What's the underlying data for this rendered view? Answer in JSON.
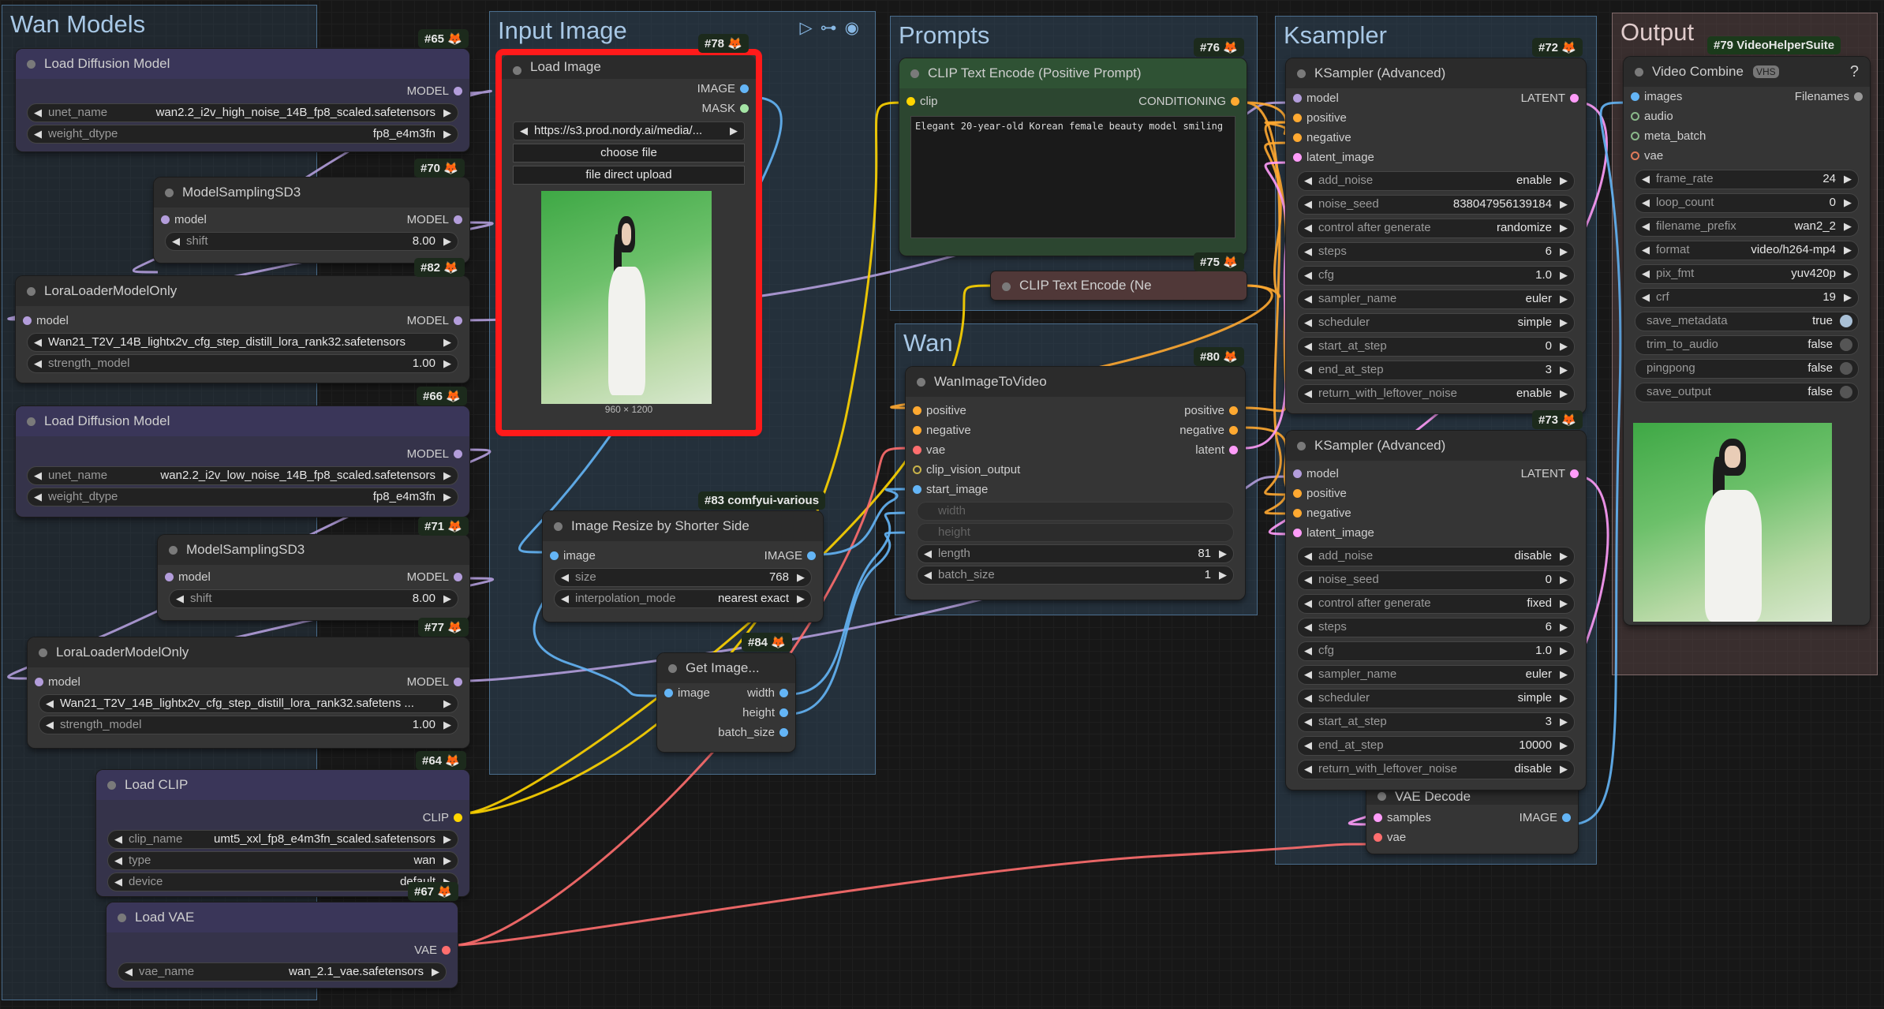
{
  "groups": {
    "wan_models": "Wan Models",
    "input_image": "Input Image",
    "prompts": "Prompts",
    "ksampler": "Ksampler",
    "output": "Output",
    "wan": "Wan"
  },
  "badges": {
    "b65": "#65",
    "b70": "#70",
    "b82": "#82",
    "b66": "#66",
    "b71": "#71",
    "b77": "#77",
    "b64": "#64",
    "b67": "#67",
    "b78": "#78",
    "b83": "#83 comfyui-various",
    "b84": "#84",
    "b76": "#76",
    "b75": "#75",
    "b80": "#80",
    "b72": "#72",
    "b73": "#73",
    "b79": "#79 VideoHelperSuite"
  },
  "fox": "🦊",
  "n65": {
    "title": "Load Diffusion Model",
    "out": "MODEL",
    "unet_k": "unet_name",
    "unet_v": "wan2.2_i2v_high_noise_14B_fp8_scaled.safetensors",
    "dt_k": "weight_dtype",
    "dt_v": "fp8_e4m3fn"
  },
  "n70": {
    "title": "ModelSamplingSD3",
    "in": "model",
    "out": "MODEL",
    "k": "shift",
    "v": "8.00"
  },
  "n82": {
    "title": "LoraLoaderModelOnly",
    "in": "model",
    "out": "MODEL",
    "lora_v": "Wan21_T2V_14B_lightx2v_cfg_step_distill_lora_rank32.safetensors",
    "s_k": "strength_model",
    "s_v": "1.00"
  },
  "n66": {
    "title": "Load Diffusion Model",
    "out": "MODEL",
    "unet_k": "unet_name",
    "unet_v": "wan2.2_i2v_low_noise_14B_fp8_scaled.safetensors",
    "dt_k": "weight_dtype",
    "dt_v": "fp8_e4m3fn"
  },
  "n71": {
    "title": "ModelSamplingSD3",
    "in": "model",
    "out": "MODEL",
    "k": "shift",
    "v": "8.00"
  },
  "n77": {
    "title": "LoraLoaderModelOnly",
    "in": "model",
    "out": "MODEL",
    "lora_v": "Wan21_T2V_14B_lightx2v_cfg_step_distill_lora_rank32.safetens ...",
    "s_k": "strength_model",
    "s_v": "1.00"
  },
  "n64": {
    "title": "Load CLIP",
    "out": "CLIP",
    "c_k": "clip_name",
    "c_v": "umt5_xxl_fp8_e4m3fn_scaled.safetensors",
    "t_k": "type",
    "t_v": "wan",
    "d_k": "device",
    "d_v": "default"
  },
  "n67": {
    "title": "Load VAE",
    "out": "VAE",
    "k": "vae_name",
    "v": "wan_2.1_vae.safetensors"
  },
  "n78": {
    "title": "Load Image",
    "out1": "IMAGE",
    "out2": "MASK",
    "url": "https://s3.prod.nordy.ai/media/...",
    "choose": "choose file",
    "upload": "file direct upload",
    "dims": "960 × 1200"
  },
  "n83": {
    "title": "Image Resize by Shorter Side",
    "in": "image",
    "out": "IMAGE",
    "size_k": "size",
    "size_v": "768",
    "interp_k": "interpolation_mode",
    "interp_v": "nearest exact"
  },
  "n84": {
    "title": "Get Image...",
    "in": "image",
    "o1": "width",
    "o2": "height",
    "o3": "batch_size"
  },
  "n76": {
    "title": "CLIP Text Encode (Positive Prompt)",
    "in": "clip",
    "out": "CONDITIONING",
    "text": "Elegant 20-year-old Korean female beauty model smiling"
  },
  "n75": {
    "title": "CLIP Text Encode (Ne"
  },
  "n80": {
    "title": "WanImageToVideo",
    "i1": "positive",
    "i2": "negative",
    "i3": "vae",
    "i4": "clip_vision_output",
    "i5": "start_image",
    "o1": "positive",
    "o2": "negative",
    "o3": "latent",
    "w1": "width",
    "w2": "height",
    "len_k": "length",
    "len_v": "81",
    "bs_k": "batch_size",
    "bs_v": "1"
  },
  "n72": {
    "title": "KSampler (Advanced)",
    "i1": "model",
    "i2": "positive",
    "i3": "negative",
    "i4": "latent_image",
    "out": "LATENT",
    "widgets": [
      [
        "add_noise",
        "enable"
      ],
      [
        "noise_seed",
        "838047956139184"
      ],
      [
        "control after generate",
        "randomize"
      ],
      [
        "steps",
        "6"
      ],
      [
        "cfg",
        "1.0"
      ],
      [
        "sampler_name",
        "euler"
      ],
      [
        "scheduler",
        "simple"
      ],
      [
        "start_at_step",
        "0"
      ],
      [
        "end_at_step",
        "3"
      ],
      [
        "return_with_leftover_noise",
        "enable"
      ]
    ]
  },
  "n73": {
    "title": "KSampler (Advanced)",
    "i1": "model",
    "i2": "positive",
    "i3": "negative",
    "i4": "latent_image",
    "out": "LATENT",
    "widgets": [
      [
        "add_noise",
        "disable"
      ],
      [
        "noise_seed",
        "0"
      ],
      [
        "control after generate",
        "fixed"
      ],
      [
        "steps",
        "6"
      ],
      [
        "cfg",
        "1.0"
      ],
      [
        "sampler_name",
        "euler"
      ],
      [
        "scheduler",
        "simple"
      ],
      [
        "start_at_step",
        "3"
      ],
      [
        "end_at_step",
        "10000"
      ],
      [
        "return_with_leftover_noise",
        "disable"
      ]
    ]
  },
  "vaedec": {
    "title": "VAE Decode",
    "i1": "samples",
    "i2": "vae",
    "out": "IMAGE"
  },
  "n79": {
    "title": "Video Combine",
    "vhs": "VHS",
    "help": "?",
    "i1": "images",
    "i2": "audio",
    "i3": "meta_batch",
    "i4": "vae",
    "out": "Filenames",
    "widgets": [
      [
        "frame_rate",
        "24"
      ],
      [
        "loop_count",
        "0"
      ],
      [
        "filename_prefix",
        "wan2_2"
      ],
      [
        "format",
        "video/h264-mp4"
      ],
      [
        "pix_fmt",
        "yuv420p"
      ],
      [
        "crf",
        "19"
      ]
    ],
    "toggles": [
      [
        "save_metadata",
        "true"
      ],
      [
        "trim_to_audio",
        "false"
      ],
      [
        "pingpong",
        "false"
      ],
      [
        "save_output",
        "false"
      ]
    ]
  },
  "colors": {
    "model": "#b39ddb",
    "clip": "#ffd500",
    "cond": "#ffa931",
    "latent": "#ff9cf9",
    "vae": "#ff6e6e",
    "image": "#64b5f6"
  }
}
